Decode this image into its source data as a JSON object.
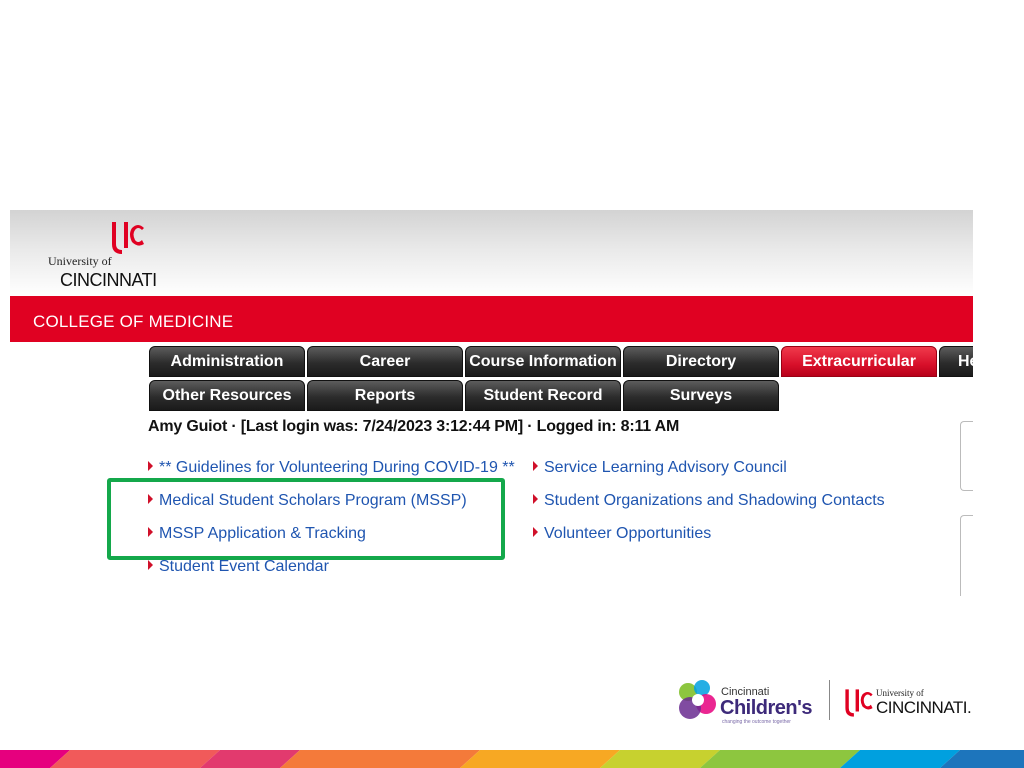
{
  "header": {
    "university_of": "University of",
    "university_name": "CINCINNATI",
    "college": "COLLEGE OF MEDICINE"
  },
  "tabs": {
    "row1": [
      "Administration",
      "Career",
      "Course Information",
      "Directory",
      "Extracurricular",
      "He"
    ],
    "row2": [
      "Other Resources",
      "Reports",
      "Student Record",
      "Surveys"
    ],
    "active": "Extracurricular"
  },
  "login_line": "Amy Guiot · [Last login was: 7/24/2023 3:12:44 PM] · Logged in: 8:11 AM",
  "links": {
    "col1": [
      "** Guidelines for Volunteering During COVID-19 **",
      "Medical Student Scholars Program (MSSP)",
      "MSSP Application & Tracking",
      "Student Event Calendar"
    ],
    "col2": [
      "Service Learning Advisory Council",
      "Student Organizations and Shadowing Contacts",
      "Volunteer Opportunities"
    ]
  },
  "footer": {
    "cch_city": "Cincinnati",
    "cch_name": "Children's",
    "cch_tagline": "changing the outcome together",
    "uc_of": "University of",
    "uc_name": "CINCINNATI."
  },
  "colors": {
    "uc_red": "#e00122",
    "highlight_green": "#14a84b",
    "link_blue": "#1f55b0"
  }
}
